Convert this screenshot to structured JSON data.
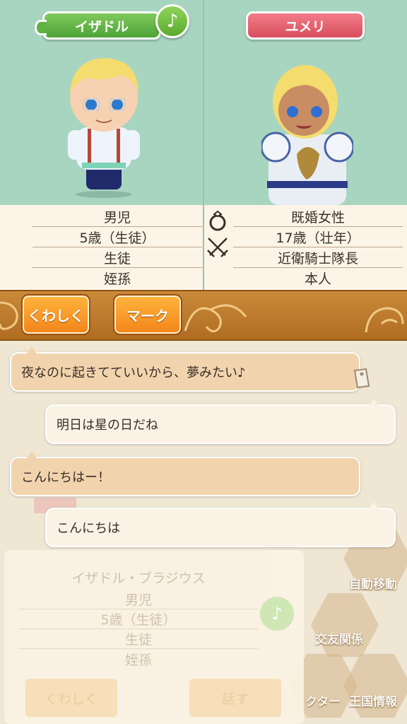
{
  "left_character": {
    "name": "イザドル",
    "gender": "男児",
    "age": "5歳（生徒）",
    "occupation": "生徒",
    "relation": "姪孫"
  },
  "right_character": {
    "name": "ユメリ",
    "gender": "既婚女性",
    "age": "17歳（壮年）",
    "occupation": "近衛騎士隊長",
    "relation": "本人"
  },
  "buttons": {
    "detail": "くわしく",
    "mark": "マーク"
  },
  "chat": [
    {
      "speaker": "partner",
      "text": "夜なのに起きてていいから、夢みたい♪"
    },
    {
      "speaker": "self",
      "text": "明日は星の日だね"
    },
    {
      "speaker": "partner",
      "text": "こんにちはー！"
    },
    {
      "speaker": "self",
      "text": "こんにちは"
    }
  ],
  "background_ui": {
    "full_name": "イザドル・ブラジウス",
    "gender": "男児",
    "age": "5歳（生徒）",
    "occupation": "生徒",
    "relation": "姪孫",
    "detail_button": "くわしく",
    "talk_button": "話す",
    "menu": [
      "自動移動",
      "交友関係",
      "クター",
      "王国情報"
    ]
  },
  "icons": {
    "music": "♪",
    "music_icon": "music-note-icon",
    "ring_icon": "ring-icon",
    "swords_icon": "crossed-swords-icon",
    "tag_icon": "bookmark-tag-icon"
  },
  "colors": {
    "panel_bg": "#a8d5c0",
    "left_plate": "#5fb143",
    "right_plate": "#e05a68",
    "button_orange": "#f7951f",
    "bar_brown": "#c07a2c"
  }
}
